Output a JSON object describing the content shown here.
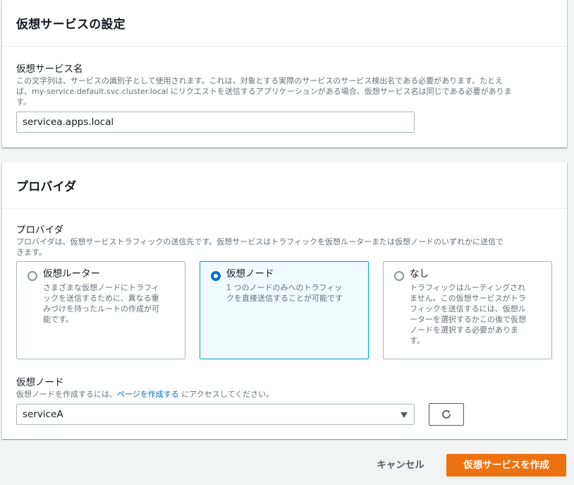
{
  "service_settings": {
    "title": "仮想サービスの設定",
    "name_label": "仮想サービス名",
    "name_desc_line1": "この文字列は、サービスの識別子として使用されます。これは、対象とする実際のサービスのサービス検出名である必要があります。たとえ",
    "name_desc_line2": "ば、my-service.default.svc.cluster.local にリクエストを送信するアプリケーションがある場合、仮想サービス名は同じである必要がありま",
    "name_desc_line3": "す。",
    "name_value": "servicea.apps.local"
  },
  "provider": {
    "title": "プロバイダ",
    "label": "プロバイダ",
    "desc_line1": "プロバイダは、仮想サービストラフィックの送信先です。仮想サービスはトラフィックを仮想ルーターまたは仮想ノードのいずれかに送信で",
    "desc_line2": "きます。",
    "options": [
      {
        "title": "仮想ルーター",
        "desc": [
          "さまざまな仮想ノードにトラフィ",
          "ックを送信するために、異なる重",
          "みづけを持ったルートの作成が可",
          "能です。"
        ],
        "selected": false
      },
      {
        "title": "仮想ノード",
        "desc": [
          "1 つのノードのみへのトラフィッ",
          "クを直接送信することが可能です"
        ],
        "selected": true
      },
      {
        "title": "なし",
        "desc": [
          "トラフィックはルーティングされ",
          "ません。この仮想サービスがトラ",
          "フィックを送信するには、仮想ル",
          "ーターを選択するかこの後で仮想",
          "ノードを選択する必要がありま",
          "す。"
        ],
        "selected": false
      }
    ],
    "node_label": "仮想ノード",
    "node_desc_pre": "仮想ノードを作成するには、",
    "node_desc_link": "ページを作成する",
    "node_desc_post": " にアクセスしてください。",
    "node_selected": "serviceA"
  },
  "footer": {
    "cancel_label": "キャンセル",
    "create_label": "仮想サービスを作成"
  },
  "colors": {
    "primary_button": "#ec7211",
    "link": "#0073bb",
    "selected_tile_border": "#00a1c9"
  }
}
